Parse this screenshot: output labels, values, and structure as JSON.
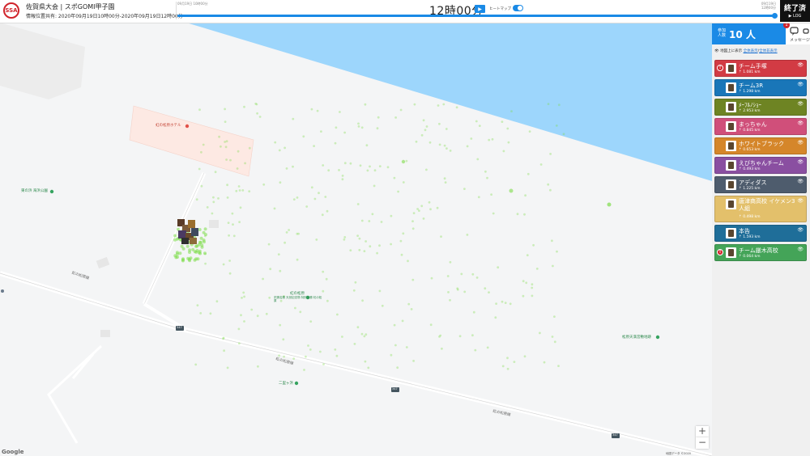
{
  "header": {
    "logo_text": "SSA",
    "title": "佐賀県大会 | スポGOMI甲子園",
    "subtitle": "情報位置共有: 2020年09月19日10時00分-2020年09月19日12時00分",
    "timeline_start": "09月19日 10時00分",
    "timeline_end": "09月19日 12時00分",
    "time_label": "12時00分",
    "play_icon": "play-icon",
    "heatmap_label": "ヒートマップ",
    "heatmap_on": true,
    "progress": 1.0,
    "end_button": {
      "line1": "終了済",
      "line2": "▶ LOG"
    }
  },
  "map": {
    "labels": {
      "hotel": "虹の松原ホテル",
      "park": "東の浜 海浜公園",
      "matsubara": "虹の松原",
      "matsubara_desc": "史蹟名勝 天然記念物 特別名勝 虹の松原",
      "tenmangu": "松原天満宮敷地跡",
      "shrine": "二里ヶ浜",
      "road1": "虹の松原線",
      "road2": "虹の松原線",
      "road3": "虹の松原線",
      "route_a": "347",
      "route_b": "347",
      "route_c": "347"
    },
    "google": "Google",
    "copyright": "地図データ ©2020"
  },
  "sidebar": {
    "count_label": "参加人数",
    "count_value": "10 人",
    "message_label": "メッセージ",
    "message_badge": "1",
    "display_prefix": "地図上に表示",
    "display_all": "全体表示",
    "display_none": "全体非表示",
    "teams": [
      {
        "name": "チーム手塚",
        "dist": "1.081 km",
        "color": "#d23b44",
        "alert": true
      },
      {
        "name": "チーム3R",
        "dist": "1.298 km",
        "color": "#1976b8",
        "alert": false
      },
      {
        "name": "ﾒｰﾌﾙﾉｼｮｰ",
        "dist": "2.953 km",
        "color": "#6e8423",
        "alert": false
      },
      {
        "name": "まっちゃん",
        "dist": "0.845 km",
        "color": "#d04f7a",
        "alert": false
      },
      {
        "name": "ホワイトブラック",
        "dist": "0.653 km",
        "color": "#d5862a",
        "alert": false
      },
      {
        "name": "えびちゃんチーム",
        "dist": "0.493 km",
        "color": "#8a4fa1",
        "alert": false
      },
      {
        "name": "アディダス",
        "dist": "1.225 km",
        "color": "#4e5c6d",
        "alert": false
      },
      {
        "name": "唐津商高校 イケメン3人組",
        "dist": "0.498 km",
        "color": "#e3c06b",
        "alert": false
      },
      {
        "name": "本告",
        "dist": "1.593 km",
        "color": "#1f6e99",
        "alert": false
      },
      {
        "name": "チーム厳木高校",
        "dist": "0.064 km",
        "color": "#44a458",
        "alert": true
      }
    ]
  },
  "colors": {
    "accent": "#1a8ae6",
    "sea": "#9dd6fc",
    "heat": "#7ddc4a"
  },
  "icons": [
    "play-icon",
    "chat-icon",
    "eye-icon",
    "pin-icon",
    "alert-icon"
  ]
}
